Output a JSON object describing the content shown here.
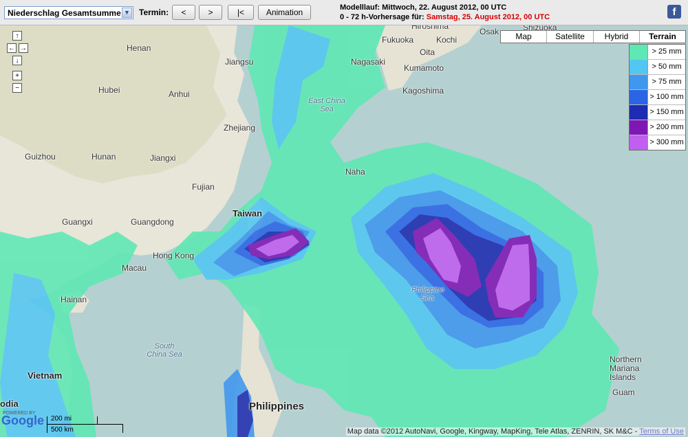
{
  "toolbar": {
    "parameter_select": "Niederschlag Gesamtsumme",
    "termin_label": "Termin:",
    "prev_label": "<",
    "next_label": ">",
    "first_label": "|<",
    "animation_label": "Animation"
  },
  "run_info": {
    "line1": "Modelllauf: Mittwoch, 22. August 2012, 00 UTC",
    "line2_prefix": "0 - 72 h-Vorhersage für:",
    "line2_value": "Samstag, 25. August 2012, 00 UTC"
  },
  "map_types": [
    "Map",
    "Satellite",
    "Hybrid",
    "Terrain"
  ],
  "map_types_active": "Terrain",
  "legend": [
    {
      "label": "> 25 mm",
      "color": "#5de8b4"
    },
    {
      "label": "> 50 mm",
      "color": "#53c6f2"
    },
    {
      "label": "> 75 mm",
      "color": "#3f97ee"
    },
    {
      "label": "> 100 mm",
      "color": "#2c64e6"
    },
    {
      "label": "> 150 mm",
      "color": "#1d2cb0"
    },
    {
      "label": "> 200 mm",
      "color": "#7f17b4"
    },
    {
      "label": "> 300 mm",
      "color": "#c05ff0"
    }
  ],
  "map_labels": {
    "henan": "Henan",
    "jiangsu": "Jiangsu",
    "hubei": "Hubei",
    "anhui": "Anhui",
    "zhejiang": "Zhejiang",
    "guizhou": "Guizhou",
    "hunan": "Hunan",
    "jiangxi": "Jiangxi",
    "fujian": "Fujian",
    "guangxi": "Guangxi",
    "guangdong": "Guangdong",
    "taiwan": "Taiwan",
    "hongkong": "Hong Kong",
    "macau": "Macau",
    "hainan": "Hainan",
    "south_china_sea": "South China Sea",
    "east_china_sea": "East China Sea",
    "philippine_sea": "Philippine Sea",
    "vietnam": "Vietnam",
    "bodia": "odia",
    "philippines": "Philippines",
    "fukuoka": "Fukuoka",
    "kochi": "Kochi",
    "oita": "Oita",
    "nagasaki": "Nagasaki",
    "kumamoto": "Kumamoto",
    "kagoshima": "Kagoshima",
    "naha": "Naha",
    "hiroshima": "Hiroshima",
    "osaka": "Osak",
    "shizuoka": "Shizuoka",
    "northern_mariana": "Northern Mariana Islands",
    "guam": "Guam"
  },
  "scale": {
    "miles": "200 mi",
    "km": "500 km"
  },
  "google": {
    "powered": "POWERED BY",
    "name": "Google"
  },
  "attribution": {
    "text": "Map data ©2012 AutoNavi, Google, Kingway, MapKing, Tele Atlas, ZENRIN, SK M&C -",
    "terms": "Terms of Use"
  }
}
